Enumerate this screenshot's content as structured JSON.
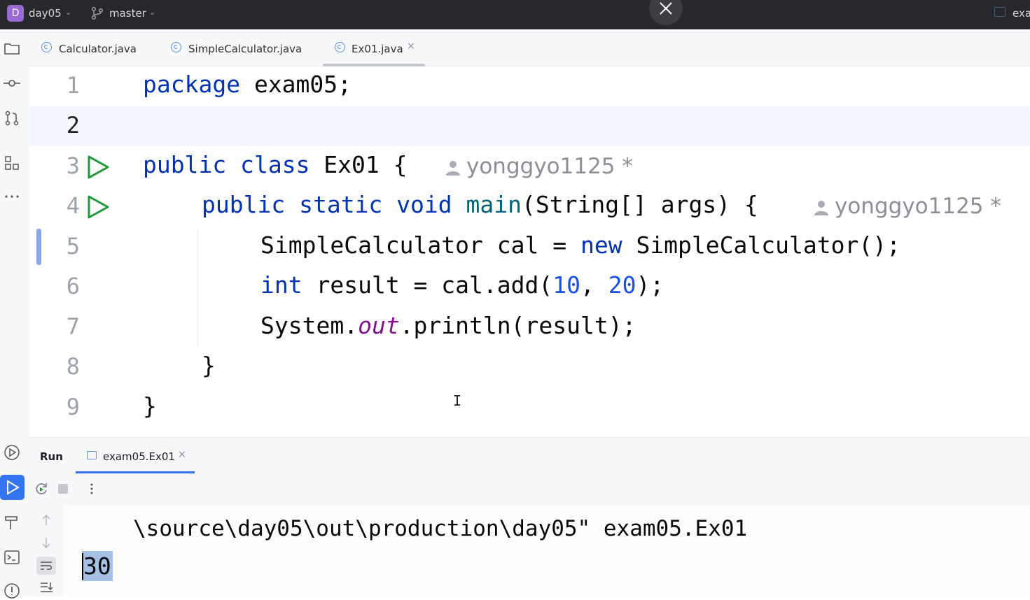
{
  "titlebar": {
    "project_badge": "D",
    "project_name": "day05",
    "branch_name": "master",
    "right_text": "exa"
  },
  "icons": {
    "project": "folder-icon",
    "commit": "commit-icon",
    "pull_requests": "pull-request-icon",
    "structure": "structure-icon",
    "more": "more-icon",
    "services": "services-icon",
    "run": "run-icon",
    "build": "hammer-icon",
    "terminal": "terminal-icon",
    "problems": "problems-icon"
  },
  "tabs": [
    {
      "label": "Calculator.java",
      "active": false
    },
    {
      "label": "SimpleCalculator.java",
      "active": false
    },
    {
      "label": "Ex01.java",
      "active": true,
      "close": "×"
    }
  ],
  "editor": {
    "current_line": 2,
    "lines": [
      {
        "n": "1"
      },
      {
        "n": "2"
      },
      {
        "n": "3",
        "hint_author": "yonggyo1125",
        "hint_mark": "*",
        "runnable": true
      },
      {
        "n": "4",
        "hint_author": "yonggyo1125",
        "hint_mark": "*",
        "runnable": true
      },
      {
        "n": "5"
      },
      {
        "n": "6"
      },
      {
        "n": "7"
      },
      {
        "n": "8"
      },
      {
        "n": "9"
      }
    ],
    "tokens": {
      "l1_kw": "package",
      "l1_rest": " exam05;",
      "l3_kw1": "public",
      "l3_kw2": "class",
      "l3_rest": " Ex01 { ",
      "l4_kw1": "public",
      "l4_kw2": "static",
      "l4_kw3": "void",
      "l4_fn": "main",
      "l4_rest": "(String[] args) { ",
      "l5_a": "SimpleCalculator cal = ",
      "l5_kw": "new",
      "l5_b": " SimpleCalculator();",
      "l6_kw": "int",
      "l6_a": " result = cal.add(",
      "l6_n1": "10",
      "l6_b": ", ",
      "l6_n2": "20",
      "l6_c": ");",
      "l7_a": "System.",
      "l7_fld": "out",
      "l7_b": ".println(result);",
      "l8": "}",
      "l9": "}"
    }
  },
  "run_panel": {
    "title": "Run",
    "config_tab": "exam05.Ex01",
    "config_close": "×",
    "console_line1": "\\source\\day05\\out\\production\\day05\" exam05.Ex01",
    "console_output": "30"
  }
}
